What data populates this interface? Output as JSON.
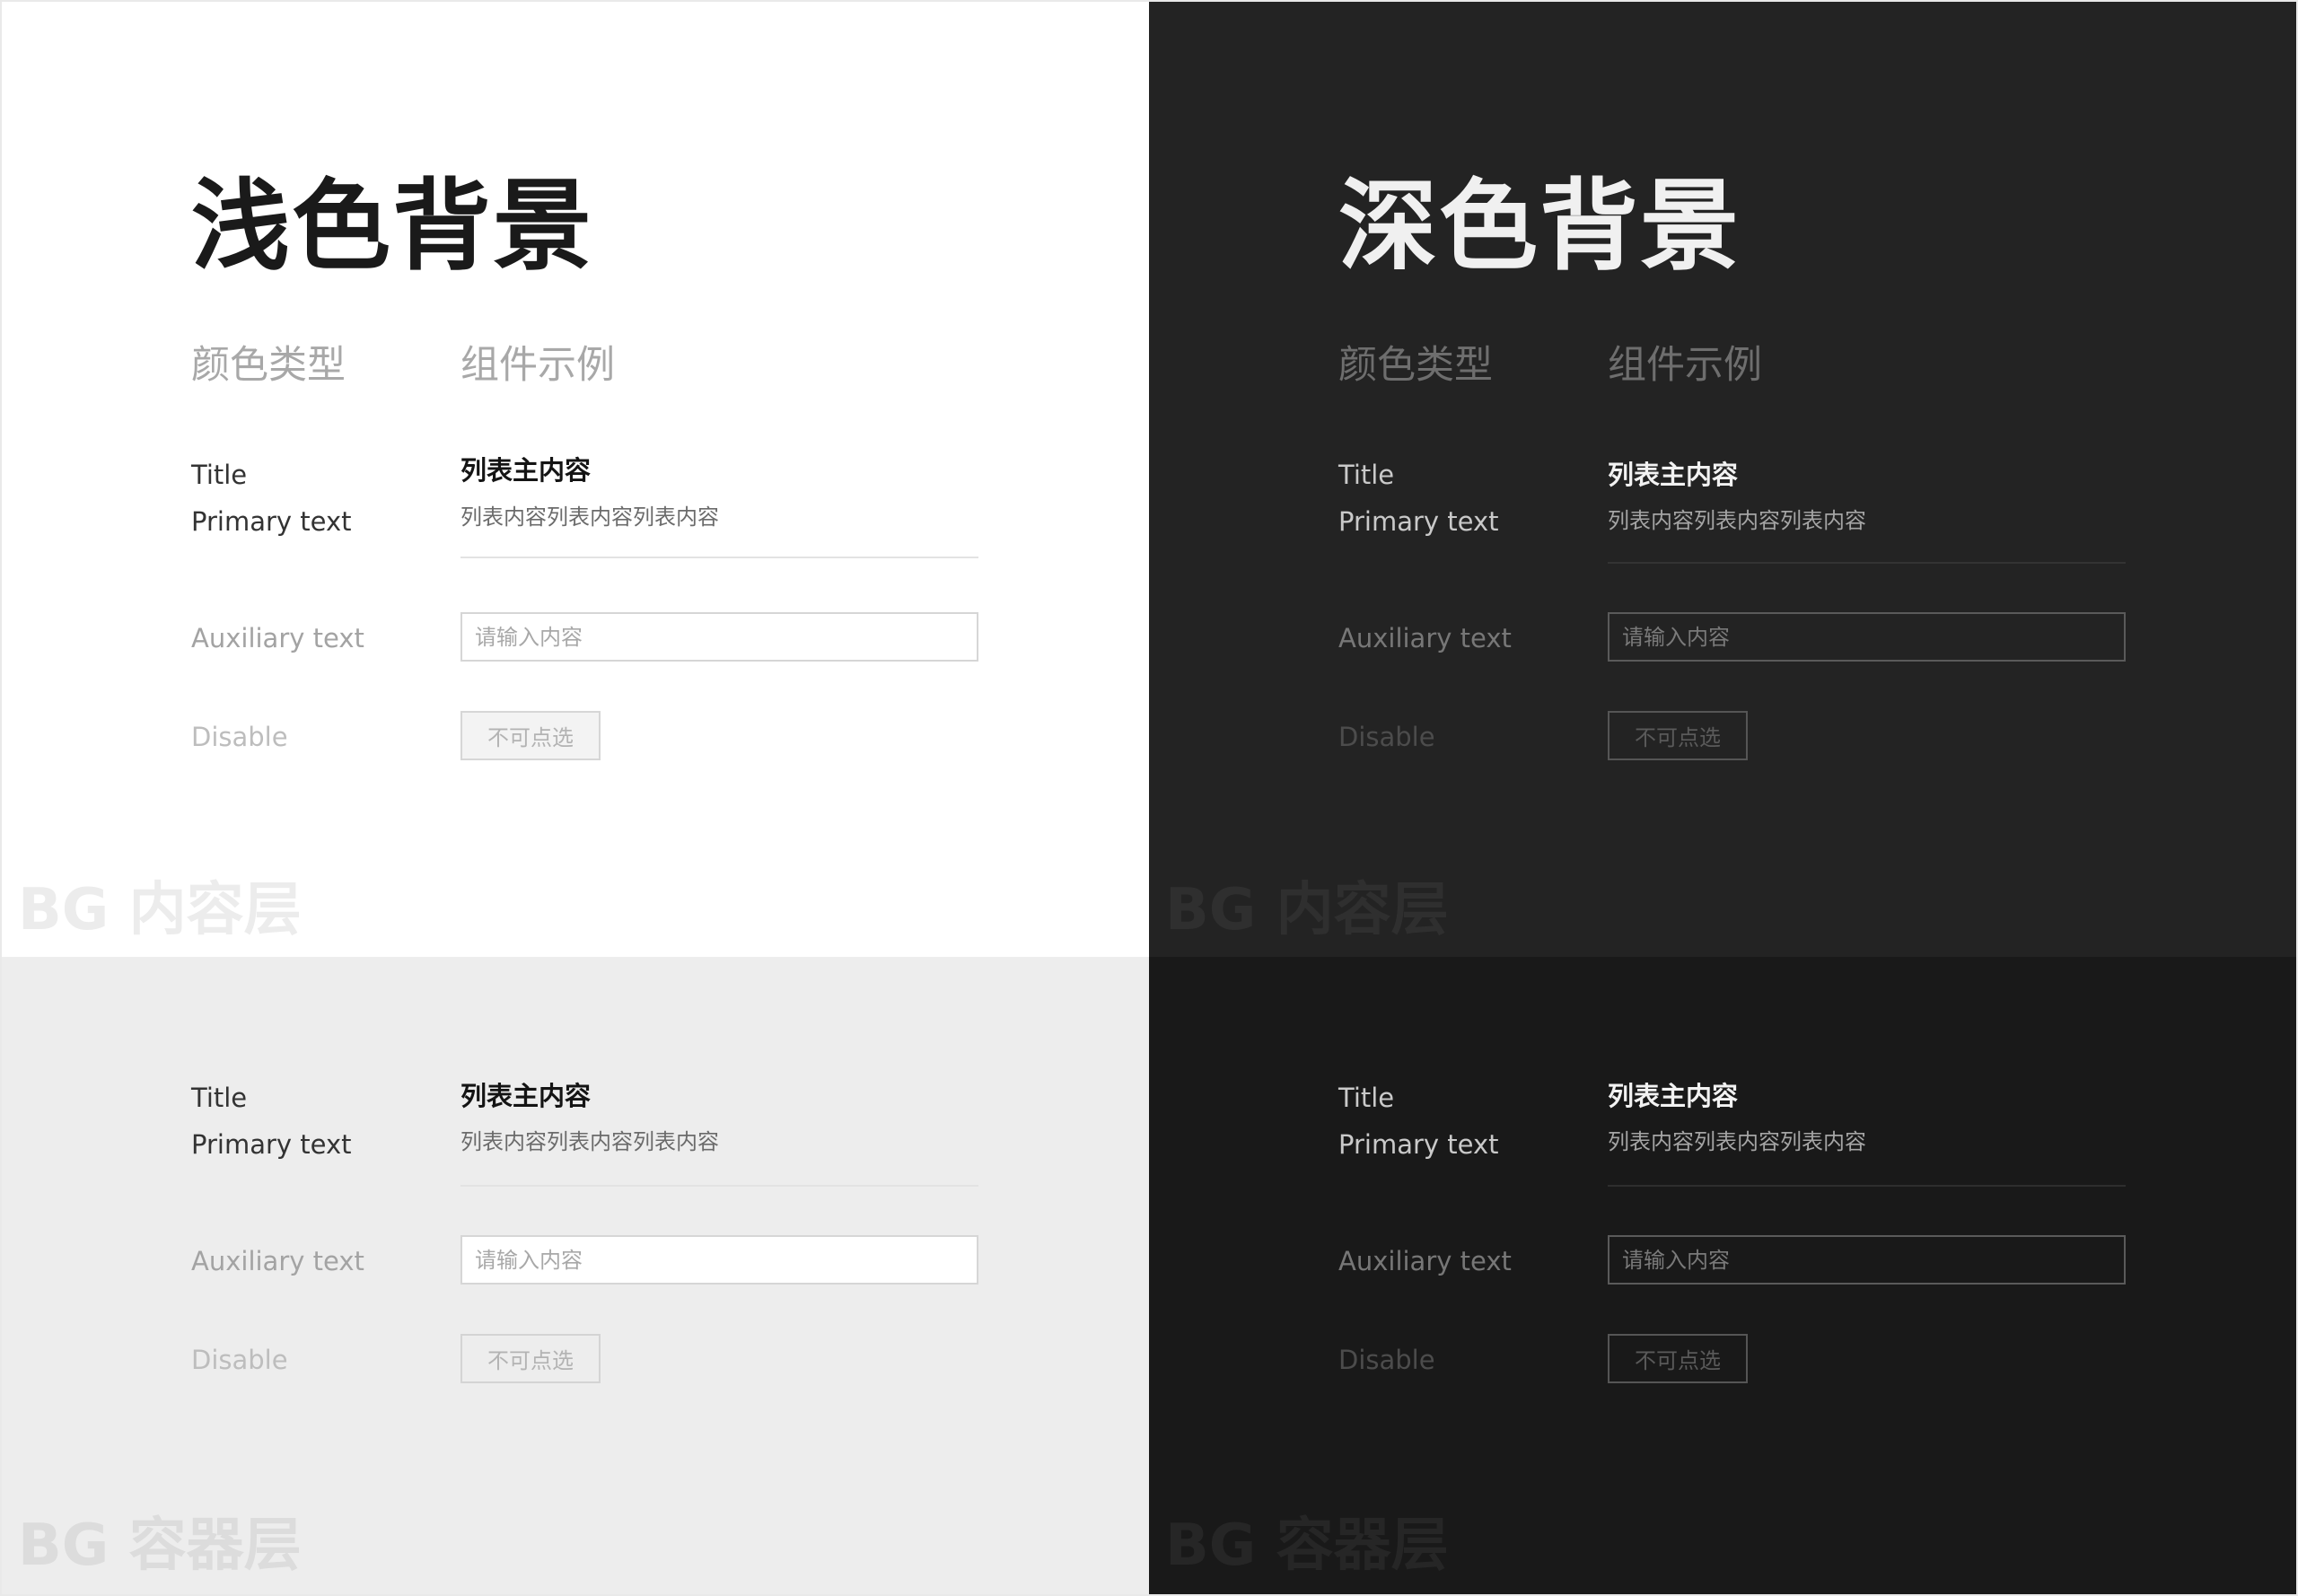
{
  "light": {
    "heading": "浅色背景",
    "column_type": "颜色类型",
    "column_example": "组件示例"
  },
  "dark": {
    "heading": "深色背景",
    "column_type": "颜色类型",
    "column_example": "组件示例"
  },
  "labels": {
    "title": "Title",
    "primary_text": "Primary text",
    "auxiliary_text": "Auxiliary text",
    "disable": "Disable"
  },
  "example": {
    "list_title": "列表主内容",
    "list_content": "列表内容列表内容列表内容",
    "input_placeholder": "请输入内容",
    "disabled_button": "不可点选"
  },
  "watermarks": {
    "content_layer": "BG 内容层",
    "container_layer": "BG 容器层"
  },
  "colors": {
    "light_content_bg": "#ffffff",
    "light_container_bg": "#ededed",
    "dark_content_bg": "#232323",
    "dark_container_bg": "#191919"
  }
}
